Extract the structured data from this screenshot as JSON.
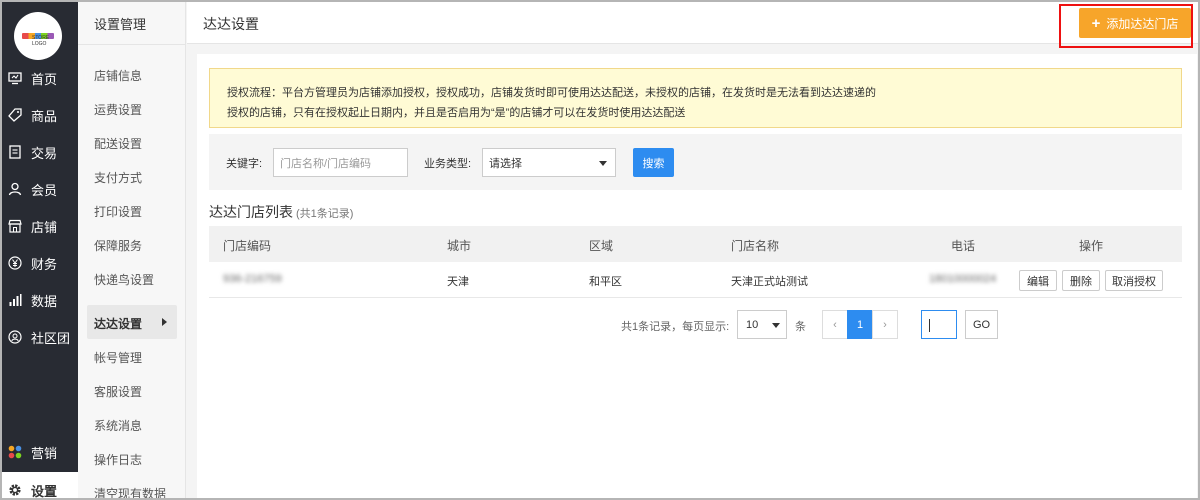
{
  "logo": {
    "text": "STORE LOGO"
  },
  "nav": {
    "items": [
      {
        "label": "首页",
        "icon": "monitor-icon"
      },
      {
        "label": "商品",
        "icon": "tag-icon"
      },
      {
        "label": "交易",
        "icon": "document-icon"
      },
      {
        "label": "会员",
        "icon": "user-icon"
      },
      {
        "label": "店铺",
        "icon": "store-icon"
      },
      {
        "label": "财务",
        "icon": "yen-icon"
      },
      {
        "label": "数据",
        "icon": "bar-chart-icon"
      },
      {
        "label": "社区团",
        "icon": "community-icon"
      }
    ],
    "bottom": [
      {
        "label": "营销",
        "icon": "marketing-dots-icon"
      },
      {
        "label": "设置",
        "icon": "gear-icon"
      }
    ]
  },
  "submenu": {
    "title": "设置管理",
    "items": [
      "店铺信息",
      "运费设置",
      "配送设置",
      "支付方式",
      "打印设置",
      "保障服务",
      "快递鸟设置"
    ],
    "active": "达达设置",
    "items_after": [
      "帐号管理",
      "客服设置",
      "系统消息",
      "操作日志",
      "清空现有数据"
    ]
  },
  "header": {
    "title": "达达设置",
    "add_button": "添加达达门店"
  },
  "notice": {
    "line1": "授权流程：平台方管理员为店铺添加授权，授权成功，店铺发货时即可使用达达配送，未授权的店铺，在发货时是无法看到达达速递的",
    "line2": "授权的店铺，只有在授权起止日期内，并且是否启用为“是”的店铺才可以在发货时使用达达配送"
  },
  "filter": {
    "keyword_label": "关键字:",
    "keyword_placeholder": "门店名称/门店编码",
    "type_label": "业务类型:",
    "type_value": "请选择",
    "search_button": "搜索"
  },
  "list": {
    "title": "达达门店列表",
    "count": "(共1条记录)",
    "columns": [
      "门店编码",
      "城市",
      "区域",
      "门店名称",
      "电话",
      "操作"
    ],
    "rows": [
      {
        "code": "936-216759",
        "city": "天津",
        "area": "和平区",
        "name": "天津正式站测试",
        "phone": "18010000024",
        "actions": [
          "编辑",
          "删除",
          "取消授权"
        ]
      }
    ]
  },
  "pagination": {
    "summary": "共1条记录，每页显示:",
    "page_size": "10",
    "unit": "条",
    "prev": "‹",
    "current": "1",
    "next": "›",
    "go_button": "GO"
  },
  "colors": {
    "sidebar": "#282b33",
    "accent": "#2d8cf0",
    "add_button": "#f7a52a",
    "highlight_outline": "#ee1111",
    "notice_bg": "#fffbd5"
  }
}
